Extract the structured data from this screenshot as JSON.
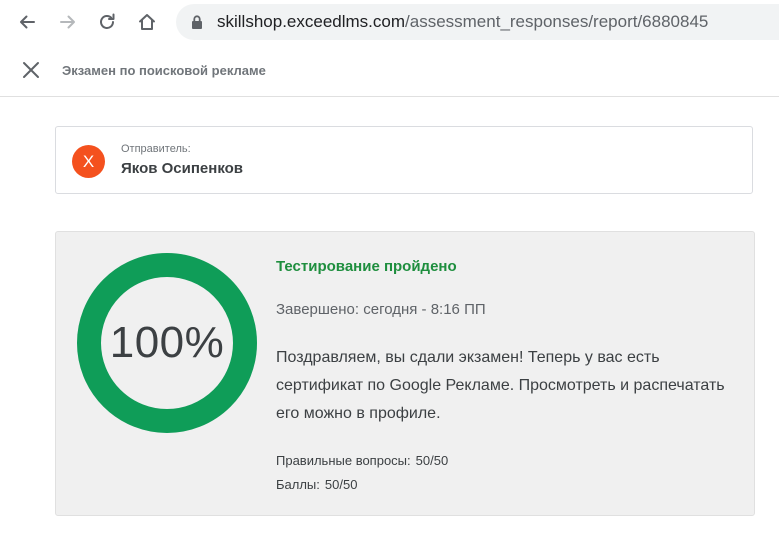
{
  "browser": {
    "url_host": "skillshop.exceedlms.com",
    "url_path": "/assessment_responses/report/6880845"
  },
  "header": {
    "title": "Экзамен по поисковой рекламе"
  },
  "sender": {
    "label": "Отправитель:",
    "avatar_letter": "Х",
    "avatar_color": "#f4511e",
    "name": "Яков Осипенков"
  },
  "result": {
    "score_fraction": 1.0,
    "score_label": "100%",
    "ring_color": "#0f9d58",
    "status": "Тестирование пройдено",
    "status_color": "#1e8e3e",
    "completed": "Завершено: сегодня - 8:16 ПП",
    "message": "Поздравляем, вы сдали экзамен! Теперь у вас есть сертификат по Google Рекламе. Просмотреть и распечатать его можно в профиле.",
    "correct_label": "Правильные вопросы:",
    "correct_value": "50/50",
    "points_label": "Баллы:",
    "points_value": "50/50"
  }
}
